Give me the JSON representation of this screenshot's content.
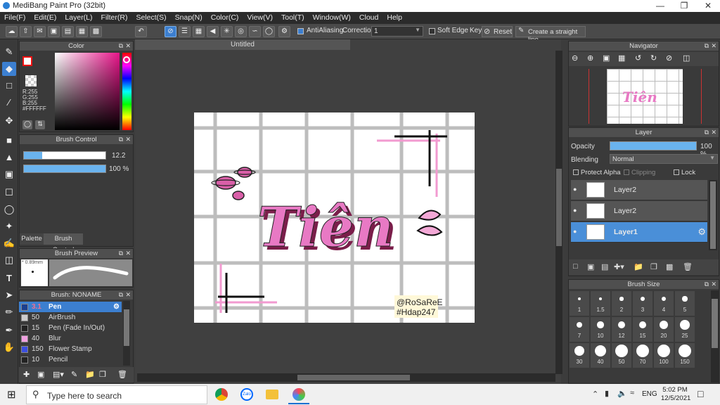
{
  "window": {
    "title": "MediBang Paint Pro (32bit)"
  },
  "menu": [
    "File(F)",
    "Edit(E)",
    "Layer(L)",
    "Filter(R)",
    "Select(S)",
    "Snap(N)",
    "Color(C)",
    "View(V)",
    "Tool(T)",
    "Window(W)",
    "Cloud",
    "Help"
  ],
  "toolbar": {
    "antialiasing_label": "AntiAliasing",
    "correction_label": "Correction",
    "correction_value": "1",
    "soft_edge_label": "Soft Edge",
    "key_label": "Key",
    "reset_label": "Reset",
    "straight_line_label": "Create a straight line"
  },
  "color_panel": {
    "title": "Color",
    "r": "R:255",
    "g": "G:255",
    "b": "B:255",
    "hex": "#FFFFFF"
  },
  "brush_control": {
    "title": "Brush Control",
    "size": "12.2",
    "opacity": "100 %",
    "size_fraction": 0.22,
    "opacity_fraction": 1.0
  },
  "palette_tabs": {
    "palette": "Palette",
    "brush_control": "Brush Control"
  },
  "brush_preview": {
    "title": "Brush Preview",
    "size": "0.89mm"
  },
  "brush_list": {
    "title": "Brush: NONAME",
    "items": [
      {
        "size": "3.1",
        "name": "Pen",
        "color": "#1c3f8f",
        "selected": true
      },
      {
        "size": "50",
        "name": "AirBrush",
        "color": "#cccccc",
        "selected": false
      },
      {
        "size": "15",
        "name": "Pen (Fade In/Out)",
        "color": "#222222",
        "selected": false
      },
      {
        "size": "40",
        "name": "Blur",
        "color": "#f0a0e0",
        "selected": false
      },
      {
        "size": "150",
        "name": "Flower Stamp",
        "color": "#3b4fe0",
        "selected": false
      },
      {
        "size": "10",
        "name": "Pencil",
        "color": "#222222",
        "selected": false
      }
    ]
  },
  "document": {
    "tab": "Untitled"
  },
  "artwork": {
    "title_text": "Tiên",
    "credit_line1": "@RoSaReE",
    "credit_line2": "#Hdap247"
  },
  "navigator": {
    "title": "Navigator"
  },
  "layer_panel": {
    "title": "Layer",
    "opacity_label": "Opacity",
    "opacity_value": "100 %",
    "opacity_fraction": 1.0,
    "blending_label": "Blending",
    "blending_value": "Normal",
    "protect_alpha": "Protect Alpha",
    "clipping": "Clipping",
    "lock": "Lock",
    "layers": [
      {
        "name": "Layer2",
        "selected": false
      },
      {
        "name": "Layer2",
        "selected": false
      },
      {
        "name": "Layer1",
        "selected": true
      }
    ]
  },
  "brush_size": {
    "title": "Brush Size",
    "sizes": [
      "1",
      "1.5",
      "2",
      "3",
      "4",
      "5",
      "7",
      "10",
      "12",
      "15",
      "20",
      "25",
      "30",
      "40",
      "50",
      "70",
      "100",
      "150"
    ]
  },
  "taskbar": {
    "search_placeholder": "Type here to search",
    "language": "ENG",
    "time": "5:02 PM",
    "date": "12/5/2021"
  },
  "colors": {
    "accent": "#3c7fd0",
    "pink": "#e879c4",
    "dark_pink": "#7a1e4a"
  }
}
